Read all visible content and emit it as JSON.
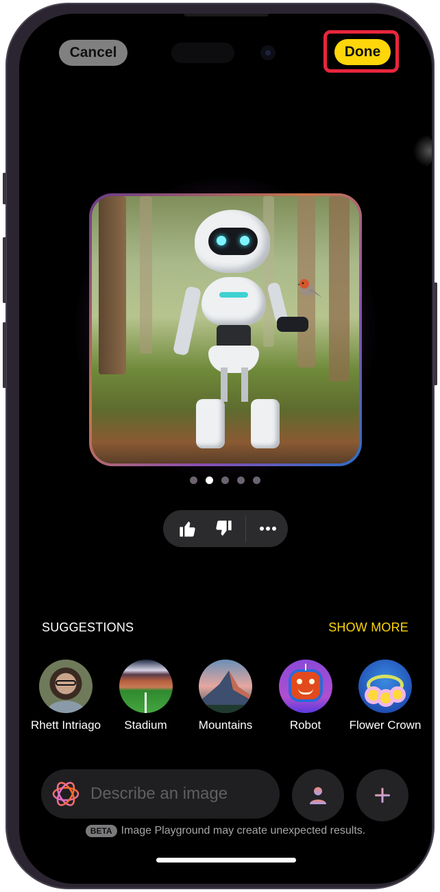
{
  "header": {
    "cancel_label": "Cancel",
    "done_label": "Done",
    "highlight_color": "#e8263c",
    "done_color": "#ffd60a"
  },
  "preview": {
    "description": "Generated image of a white robot holding a robin in a forest",
    "page_count": 5,
    "current_page": 2
  },
  "feedback": {
    "thumbs_up_icon": "hand-thumbsup-fill",
    "thumbs_down_icon": "hand-thumbsdown-fill",
    "more_icon": "ellipsis"
  },
  "suggestions": {
    "title": "SUGGESTIONS",
    "show_more_label": "SHOW MORE",
    "items": [
      {
        "label": "Rhett Intriago",
        "icon": "person-photo"
      },
      {
        "label": "Stadium",
        "icon": "stadium-image"
      },
      {
        "label": "Mountains",
        "icon": "mountain-image"
      },
      {
        "label": "Robot",
        "icon": "robot-image"
      },
      {
        "label": "Flower Crown",
        "icon": "flower-crown-image"
      }
    ]
  },
  "prompt": {
    "placeholder": "Describe an image",
    "value": ""
  },
  "footer": {
    "beta_badge": "BETA",
    "disclaimer": "Image Playground may create unexpected results."
  }
}
